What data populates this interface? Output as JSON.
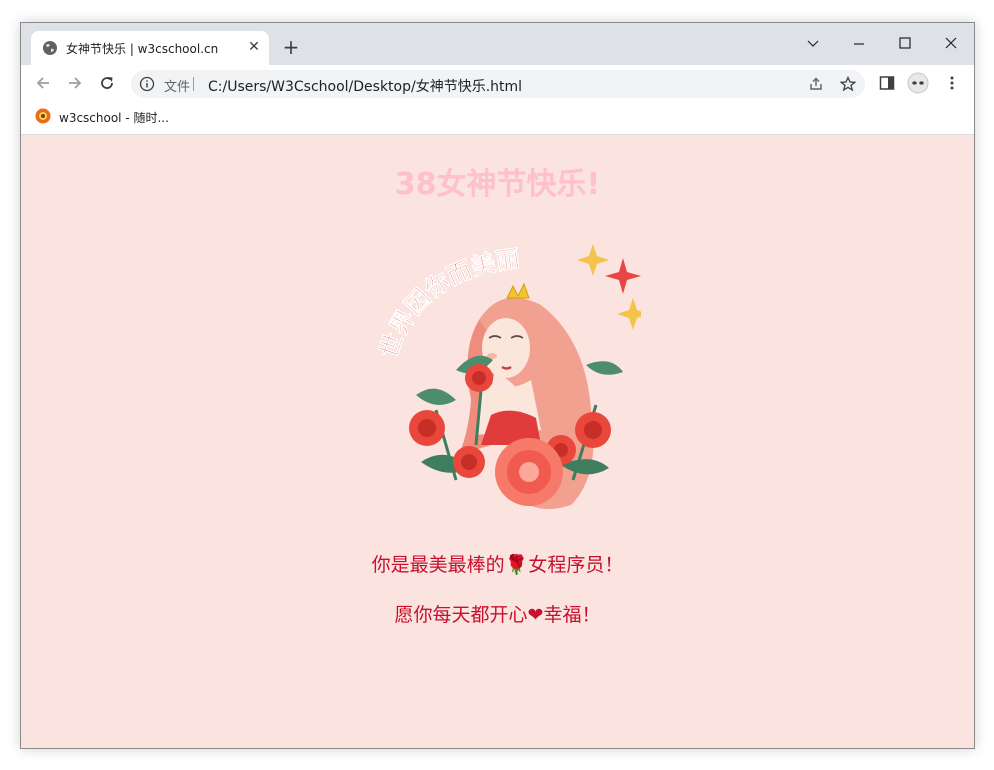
{
  "browser": {
    "tab": {
      "title": "女神节快乐 | w3cschool.cn",
      "favicon": "globe-icon",
      "close_icon": "close-icon"
    },
    "new_tab_icon": "plus-icon",
    "window_controls": [
      "chevron-down-icon",
      "minimize-icon",
      "maximize-icon",
      "close-icon"
    ],
    "nav": [
      "back-arrow-icon",
      "forward-arrow-icon",
      "reload-icon"
    ],
    "omnibox": {
      "scheme_label": "文件",
      "url": "C:/Users/W3Cschool/Desktop/女神节快乐.html",
      "icons": [
        "info-icon",
        "share-icon",
        "star-icon"
      ]
    },
    "toolbar_icons": [
      "side-panel-icon",
      "profile-avatar-icon",
      "more-menu-icon"
    ],
    "bookmarks": [
      {
        "label": "w3cschool - 随时...",
        "icon": "w3cschool-favicon"
      }
    ]
  },
  "page": {
    "headline": "38女神节快乐!",
    "illustration": {
      "caption_text": "世界因你而美丽"
    },
    "lines": {
      "line1_before": "你是最美最棒的",
      "line1_emoji": "🌹",
      "line1_after": "女程序员！",
      "line2_before": "愿你每天都开心",
      "line2_emoji": "❤",
      "line2_after": "幸福！"
    }
  },
  "colors": {
    "page_background": "#fbe3df",
    "headline": "#ffc0cb",
    "message_text": "#c8102e",
    "browser_chrome": "#dee1e6"
  }
}
